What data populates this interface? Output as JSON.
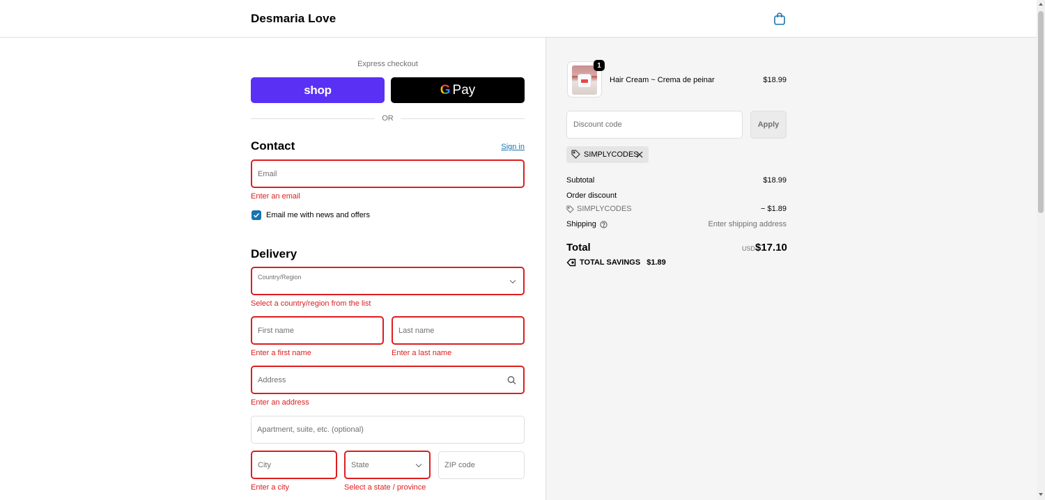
{
  "header": {
    "brand": "Desmaria Love",
    "cart_icon": "shopping-bag-icon"
  },
  "express": {
    "label": "Express checkout",
    "shop_label": "shop",
    "gpay_g": "G",
    "gpay_label": "Pay",
    "or_label": "OR"
  },
  "contact": {
    "title": "Contact",
    "signin_label": "Sign in",
    "email_placeholder": "Email",
    "email_error": "Enter an email",
    "newsletter_label": "Email me with news and offers",
    "newsletter_checked": true
  },
  "delivery": {
    "title": "Delivery",
    "country_label": "Country/Region",
    "country_error": "Select a country/region from the list",
    "first_name_placeholder": "First name",
    "first_name_error": "Enter a first name",
    "last_name_placeholder": "Last name",
    "last_name_error": "Enter a last name",
    "address_placeholder": "Address",
    "address_error": "Enter an address",
    "apartment_placeholder": "Apartment, suite, etc. (optional)",
    "city_placeholder": "City",
    "city_error": "Enter a city",
    "state_placeholder": "State",
    "state_error": "Select a state / province",
    "zip_placeholder": "ZIP code"
  },
  "summary": {
    "item": {
      "name": "Hair Cream ~ Crema de peinar",
      "price": "$18.99",
      "quantity": "1"
    },
    "discount_placeholder": "Discount code",
    "apply_label": "Apply",
    "applied_code": "SIMPLYCODES",
    "subtotal_label": "Subtotal",
    "subtotal_value": "$18.99",
    "order_discount_label": "Order discount",
    "order_discount_code": "SIMPLYCODES",
    "order_discount_value": "− $1.89",
    "shipping_label": "Shipping",
    "shipping_value": "Enter shipping address",
    "total_label": "Total",
    "total_currency": "USD",
    "total_value": "$17.10",
    "savings_label": "TOTAL SAVINGS",
    "savings_value": "$1.89"
  },
  "colors": {
    "accent": "#1773b0",
    "error": "#dd1d1d",
    "shop_pay": "#5a31f4"
  }
}
